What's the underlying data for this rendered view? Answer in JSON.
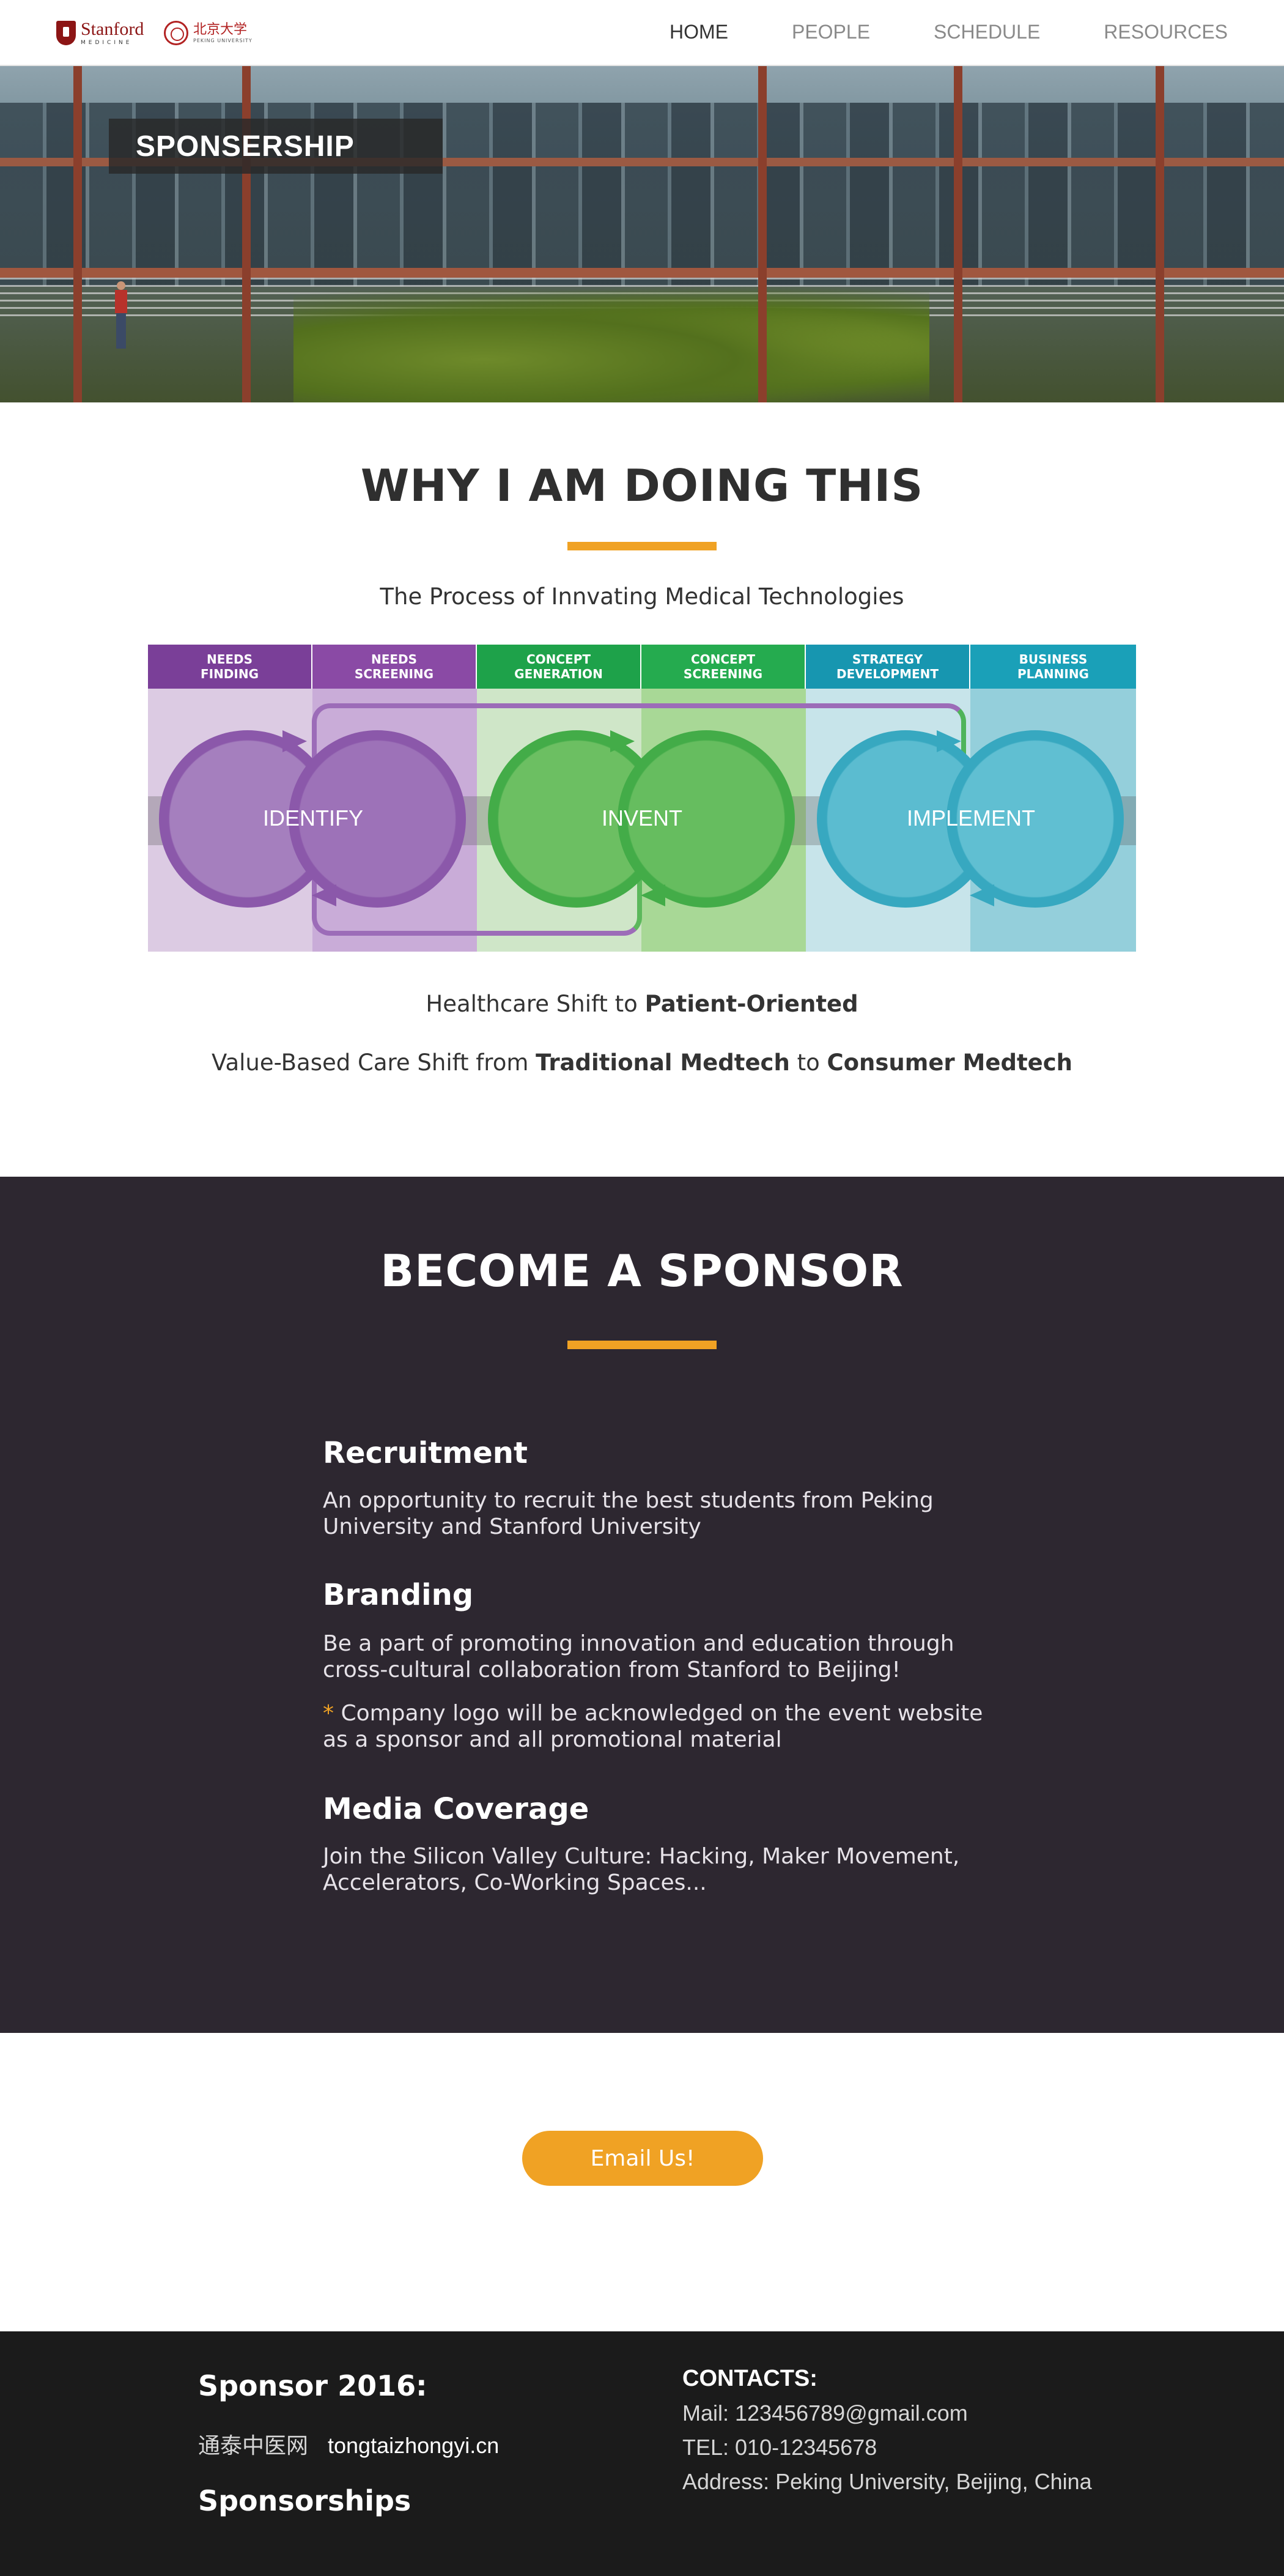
{
  "header": {
    "logo_stanford": "Stanford",
    "logo_stanford_sub": "MEDICINE",
    "logo_pku": "北京大学",
    "logo_pku_sub": "PEKING UNIVERSITY",
    "nav": [
      {
        "label": "HOME",
        "active": true
      },
      {
        "label": "PEOPLE",
        "active": false
      },
      {
        "label": "SCHEDULE",
        "active": false
      },
      {
        "label": "RESOURCES",
        "active": false
      }
    ]
  },
  "hero": {
    "label": "SPONSERSHIP"
  },
  "why": {
    "title": "WHY I AM DOING THIS",
    "subtitle": "The Process of Innvating Medical Technologies",
    "process": {
      "headers": [
        "NEEDS\nFINDING",
        "NEEDS\nSCREENING",
        "CONCEPT\nGENERATION",
        "CONCEPT\nSCREENING",
        "STRATEGY\nDEVELOPMENT",
        "BUSINESS\nPLANNING"
      ],
      "header_colors": [
        "#7a3f98",
        "#8a4aa5",
        "#1ea24a",
        "#25ab4f",
        "#1796b0",
        "#1aa0b8"
      ],
      "stages": [
        "IDENTIFY",
        "INVENT",
        "IMPLEMENT"
      ]
    },
    "shift1_prefix": "Healthcare Shift to ",
    "shift1_bold": "Patient-Oriented",
    "shift2_prefix": "Value-Based Care Shift from ",
    "shift2_bold1": "Traditional Medtech",
    "shift2_mid": " to ",
    "shift2_bold2": "Consumer Medtech"
  },
  "sponsor": {
    "title": "BECOME A SPONSOR",
    "benefits": [
      {
        "title": "Recruitment",
        "text": "An opportunity to recruit the best students from Peking University and Stanford University"
      },
      {
        "title": "Branding",
        "text": "Be a part of promoting innovation and education through cross-cultural collaboration from Stanford to Beijing!",
        "note_star": "*",
        "note": " Company logo will be acknowledged on the event website as a sponsor and all promotional material"
      },
      {
        "title": "Media Coverage",
        "text": "Join the Silicon Valley Culture: Hacking, Maker Movement, Accelerators, Co-Working Spaces..."
      }
    ]
  },
  "email_button": "Email Us!",
  "footer": {
    "sponsor_title": "Sponsor 2016:",
    "sponsor_name": "通泰中医网",
    "sponsor_site": "tongtaizhongyi.cn",
    "sponsorships": "Sponsorships",
    "contacts_title": "CONTACTS:",
    "mail": "Mail: 123456789@gmail.com",
    "tel": "TEL: 010-12345678",
    "address": "Address: Peking University, Beijing, China"
  },
  "colors": {
    "accent": "#f0a224",
    "dark_section": "#2d2730",
    "footer": "#1b1b1b",
    "identify": "#9b6bb5",
    "invent": "#5cb85c",
    "implement": "#4cb3c8"
  }
}
